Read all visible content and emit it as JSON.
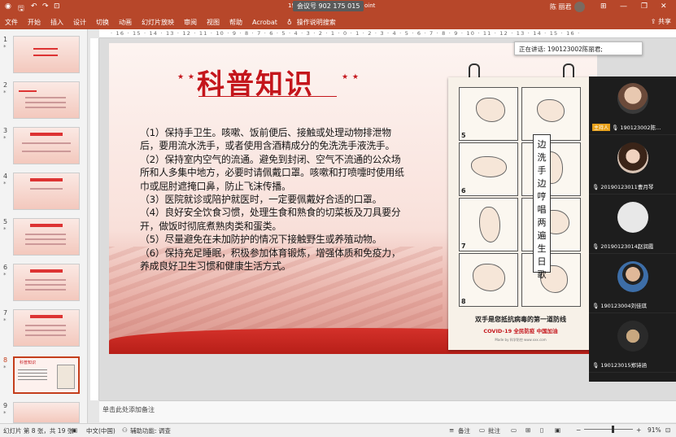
{
  "titlebar": {
    "window_title": "会议号 902 175 015",
    "title_left": "19",
    "title_right": "oint",
    "user": "陈 丽君",
    "autosave_icon": "save-icon"
  },
  "ribbon": {
    "tabs": [
      "文件",
      "开始",
      "插入",
      "设计",
      "切换",
      "动画",
      "幻灯片放映",
      "审阅",
      "视图",
      "帮助",
      "Acrobat"
    ],
    "search_label": "操作说明搜索",
    "share_label": "共享"
  },
  "thumbnails": {
    "items": [
      {
        "num": "1",
        "star": "*"
      },
      {
        "num": "2",
        "star": "*"
      },
      {
        "num": "3",
        "star": "*"
      },
      {
        "num": "4",
        "star": "*"
      },
      {
        "num": "5",
        "star": "*"
      },
      {
        "num": "6",
        "star": "*"
      },
      {
        "num": "7",
        "star": "*"
      },
      {
        "num": "8",
        "star": "*",
        "selected": true,
        "label": "科普知识"
      },
      {
        "num": "9",
        "star": "*"
      }
    ]
  },
  "ruler": {
    "marks": "· 16 · 15 · 14 · 13 · 12 · 11 · 10 · 9 · 8 · 7 · 6 · 5 · 4 · 3 · 2 · 1 · 0 · 1 · 2 · 3 · 4 · 5 · 6 · 7 · 8 · 9 · 10 · 11 · 12 · 13 · 14 · 15 · 16 ·"
  },
  "slide": {
    "title": "科普知识",
    "star_left": "★ ★",
    "star_right": "★ ★",
    "paragraphs": [
      "（1）保持手卫生。咳嗽、饭前便后、接触或处理动物排泄物后，要用流水洗手，或者使用含酒精成分的免洗洗手液洗手。",
      "（2）保持室内空气的流通。避免到封闭、空气不流通的公众场所和人多集中地方，必要时请佩戴口罩。咳嗽和打喷嚏时使用纸巾或屈肘遮掩口鼻，防止飞沫传播。",
      "（3）医院就诊或陪护就医时，一定要佩戴好合适的口罩。",
      "（4）良好安全饮食习惯，处理生食和熟食的切菜板及刀具要分开，做饭时彻底煮熟肉类和蛋类。",
      "（5）尽量避免在未加防护的情况下接触野生或养殖动物。",
      "（6）保持充足睡眠，积极参加体育锻炼，增强体质和免疫力，养成良好卫生习惯和健康生活方式。"
    ],
    "poster": {
      "banner": "边洗手边哼唱两遍生日歌",
      "title": "双手是您抵抗病毒的第一道防线",
      "subtitle": "COVID-19 全民防疫 中国加油",
      "small": "Made by 科学防控 www.xxx.com",
      "step_numbers": [
        "5",
        "6",
        "7",
        "8"
      ]
    }
  },
  "notes": {
    "placeholder": "单击此处添加备注"
  },
  "statusbar": {
    "slide_info": "幻灯片 第 8 张，共 19 张",
    "language": "中文(中国)",
    "accessibility": "辅助功能: 调查",
    "notes_btn": "备注",
    "comments_btn": "批注",
    "zoom": "91%"
  },
  "meeting": {
    "speaking": "正在讲话: 190123002陈丽君;",
    "participants": [
      {
        "name": "190123002陈...",
        "host": "主持人"
      },
      {
        "name": "20190123011曹月琴"
      },
      {
        "name": "20190123014赵润霞"
      },
      {
        "name": "190123004刘佳琪"
      },
      {
        "name": "190123015郑诗涵"
      }
    ]
  }
}
